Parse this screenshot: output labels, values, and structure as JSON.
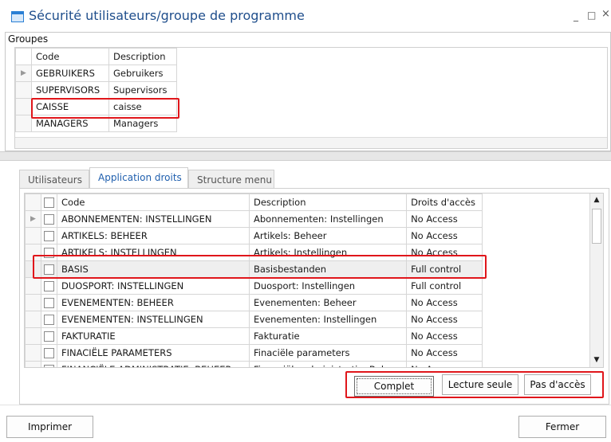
{
  "window": {
    "title": "Sécurité utilisateurs/groupe de programme",
    "minimize_glyph": "_",
    "maximize_glyph": "□",
    "close_glyph": "×"
  },
  "groups": {
    "label": "Groupes",
    "columns": [
      "Code",
      "Description"
    ],
    "rows": [
      {
        "code": "GEBRUIKERS",
        "description": "Gebruikers"
      },
      {
        "code": "SUPERVISORS",
        "description": "Supervisors"
      },
      {
        "code": "CAISSE",
        "description": "caisse"
      },
      {
        "code": "MANAGERS",
        "description": "Managers"
      }
    ],
    "current_row_indicator": "▶"
  },
  "tabs": [
    {
      "label": "Utilisateurs",
      "active": false
    },
    {
      "label": "Application droits",
      "active": true
    },
    {
      "label": "Structure menu",
      "active": false
    }
  ],
  "rights": {
    "columns": [
      "Code",
      "Description",
      "Droits d'accès"
    ],
    "rows": [
      {
        "code": "ABONNEMENTEN: INSTELLINGEN",
        "description": "Abonnementen: Instellingen",
        "access": "No Access"
      },
      {
        "code": "ARTIKELS: BEHEER",
        "description": "Artikels: Beheer",
        "access": "No Access"
      },
      {
        "code": "ARTIKELS: INSTELLINGEN",
        "description": "Artikels: Instellingen",
        "access": "No Access"
      },
      {
        "code": "BASIS",
        "description": "Basisbestanden",
        "access": "Full control"
      },
      {
        "code": "DUOSPORT: INSTELLINGEN",
        "description": "Duosport: Instellingen",
        "access": "Full control"
      },
      {
        "code": "EVENEMENTEN: BEHEER",
        "description": "Evenementen: Beheer",
        "access": "No Access"
      },
      {
        "code": "EVENEMENTEN: INSTELLINGEN",
        "description": "Evenementen: Instellingen",
        "access": "No Access"
      },
      {
        "code": "FAKTURATIE",
        "description": "Fakturatie",
        "access": "No Access"
      },
      {
        "code": "FINACIËLE PARAMETERS",
        "description": "Finaciële parameters",
        "access": "No Access"
      },
      {
        "code": "FINANCIËLE ADMINISTRATIE: BEHEER",
        "description": "Financiële administratie: Beheer",
        "access": "No Access"
      }
    ],
    "current_row_indicator": "▶",
    "scroll_up": "▲",
    "scroll_down": "▼"
  },
  "actions": {
    "complet": "Complet",
    "lecture_seule": "Lecture seule",
    "pas_acces": "Pas d'accès"
  },
  "footer": {
    "print": "Imprimer",
    "close": "Fermer"
  },
  "colors": {
    "highlight": "#e0161b",
    "title": "#1f4e8c",
    "active_tab": "#1f5fae"
  }
}
